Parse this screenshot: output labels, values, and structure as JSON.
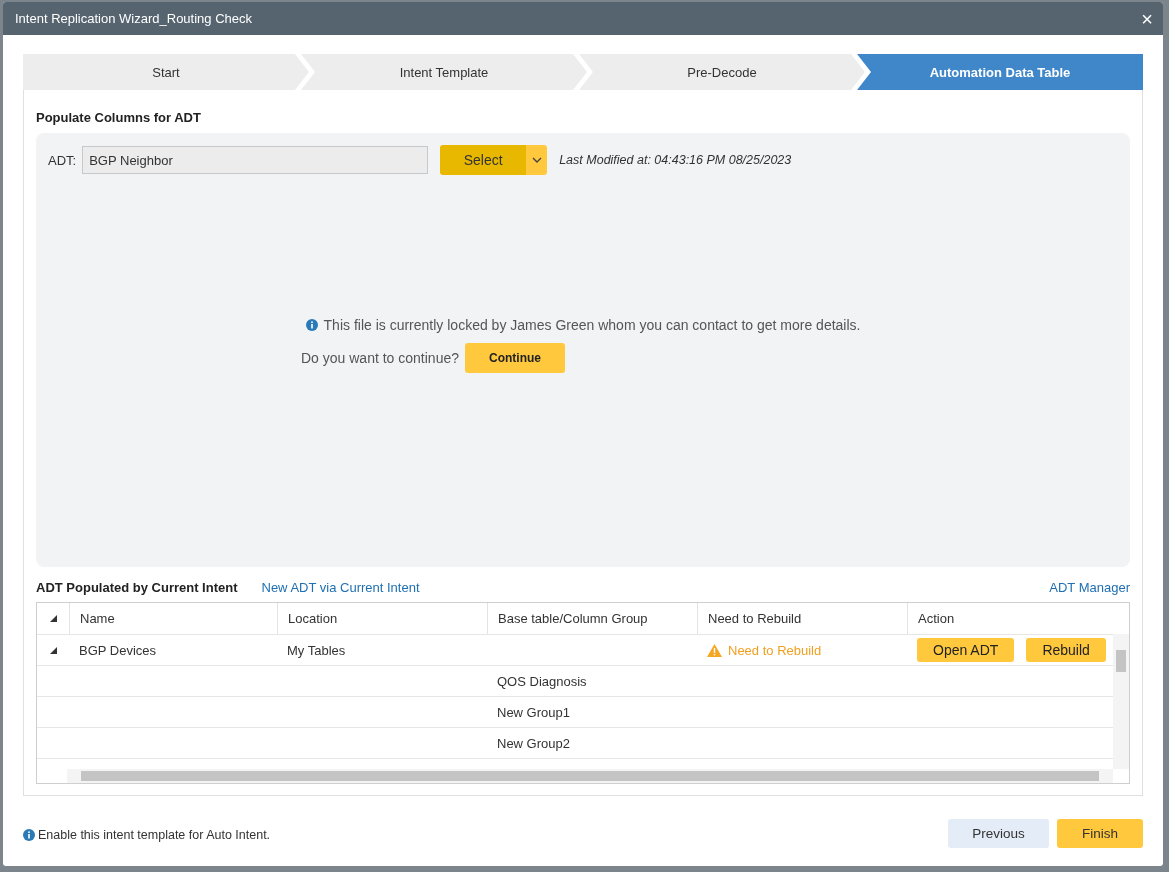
{
  "window": {
    "title": "Intent Replication Wizard_Routing Check",
    "close": "×"
  },
  "steps": [
    {
      "label": "Start",
      "selected": false
    },
    {
      "label": "Intent Template",
      "selected": false
    },
    {
      "label": "Pre-Decode",
      "selected": false
    },
    {
      "label": "Automation Data Table",
      "selected": true
    }
  ],
  "populate": {
    "heading": "Populate Columns for ADT",
    "adt_label": "ADT:",
    "adt_value": "BGP Neighbor",
    "select_button": "Select",
    "last_modified": "Last Modified at: 04:43:16 PM 08/25/2023",
    "lock_message": "This file is currently locked by James Green whom you can contact to get more details.",
    "continue_prompt": "Do you want to continue?",
    "continue_button": "Continue"
  },
  "adt_section": {
    "heading": "ADT Populated by Current Intent",
    "new_link": "New ADT via Current Intent",
    "manager_link": "ADT Manager"
  },
  "table": {
    "columns": [
      "Name",
      "Location",
      "Base table/Column Group",
      "Need to Rebuild",
      "Action"
    ],
    "rows": [
      {
        "name": "BGP Devices",
        "location": "My Tables",
        "expanded": true,
        "rebuild": "Need to Rebuild",
        "actions": [
          "Open ADT",
          "Rebuild"
        ],
        "children": [
          {
            "group": "QOS Diagnosis"
          },
          {
            "group": "New Group1"
          },
          {
            "group": "New Group2"
          }
        ]
      }
    ]
  },
  "footer": {
    "note": "Enable this intent template for Auto Intent.",
    "buttons": [
      {
        "label": "Previous",
        "kind": "secondary"
      },
      {
        "label": "Finish",
        "kind": "primary"
      }
    ]
  }
}
